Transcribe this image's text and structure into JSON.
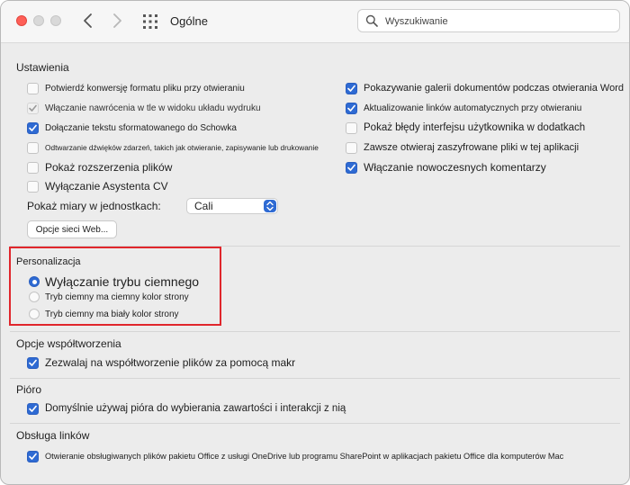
{
  "window": {
    "title": "Ogólne"
  },
  "search": {
    "placeholder": "Wyszukiwanie"
  },
  "colors": {
    "accent": "#2e6ad3",
    "highlight": "#e0262c",
    "close": "#fe5f57"
  },
  "icons": {
    "close": "close-button-icon",
    "back": "chevron-left-icon",
    "forward": "chevron-right-icon",
    "grid": "grid-icon",
    "search": "search-icon",
    "check": "checkmark-icon",
    "popup": "updown-arrows-icon"
  },
  "settings": {
    "title": "Ustawienia",
    "left": [
      {
        "label": "Potwierdź konwersję formatu pliku przy otwieraniu",
        "checked": false,
        "disabled": false
      },
      {
        "label": "Włączanie nawrócenia w tle w widoku układu wydruku",
        "checked": true,
        "disabled": true
      },
      {
        "label": "Dołączanie tekstu sformatowanego do Schowka",
        "checked": true,
        "disabled": false
      },
      {
        "label": "Odtwarzanie dźwięków zdarzeń, takich jak otwieranie, zapisywanie lub drukowanie",
        "checked": false,
        "disabled": false
      },
      {
        "label": "Pokaż rozszerzenia plików",
        "checked": false,
        "disabled": false
      },
      {
        "label": "Wyłączanie Asystenta CV",
        "checked": false,
        "disabled": false
      }
    ],
    "right": [
      {
        "label": "Pokazywanie galerii dokumentów podczas otwierania Word",
        "checked": true
      },
      {
        "label": "Aktualizowanie linków automatycznych przy otwieraniu",
        "checked": true
      },
      {
        "label": "Pokaż błędy interfejsu użytkownika w dodatkach",
        "checked": false
      },
      {
        "label": "Zawsze otwieraj zaszyfrowane pliki w tej aplikacji",
        "checked": false
      },
      {
        "label": "Włączanie nowoczesnych komentarzy",
        "checked": true
      }
    ],
    "units_label": "Pokaż miary w jednostkach:",
    "units_value": "Cali",
    "web_options_button": "Opcje sieci Web..."
  },
  "personalization": {
    "title": "Personalizacja",
    "options": [
      {
        "label": "Wyłączanie trybu ciemnego",
        "selected": true
      },
      {
        "label": "Tryb ciemny ma ciemny kolor strony",
        "selected": false
      },
      {
        "label": "Tryb ciemny ma biały kolor strony",
        "selected": false
      }
    ]
  },
  "coauthoring": {
    "title": "Opcje współtworzenia",
    "items": [
      {
        "label": "Zezwalaj na współtworzenie plików za pomocą makr",
        "checked": true
      }
    ]
  },
  "pen": {
    "title": "Pióro",
    "items": [
      {
        "label": "Domyślnie używaj pióra do wybierania zawartości i interakcji z nią",
        "checked": true
      }
    ]
  },
  "links": {
    "title": "Obsługa linków",
    "items": [
      {
        "label": "Otwieranie obsługiwanych plików pakietu Office z usługi OneDrive lub programu SharePoint w aplikacjach pakietu Office dla komputerów Mac",
        "checked": true
      }
    ]
  }
}
